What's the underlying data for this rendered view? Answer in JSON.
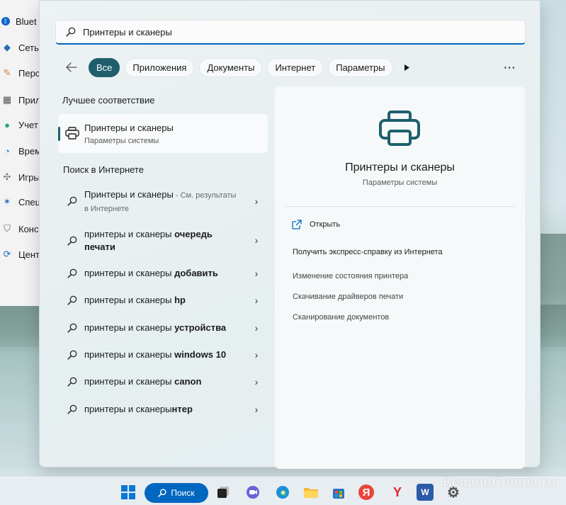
{
  "settings_sidebar": {
    "items": [
      {
        "label": "Bluet",
        "icon": "bluetooth-icon"
      },
      {
        "label": "Сеть",
        "icon": "network-icon"
      },
      {
        "label": "Перс",
        "icon": "personalization-icon"
      },
      {
        "label": "Прил",
        "icon": "apps-icon"
      },
      {
        "label": "Учет",
        "icon": "accounts-icon"
      },
      {
        "label": "Врем",
        "icon": "time-language-icon"
      },
      {
        "label": "Игры",
        "icon": "gaming-icon"
      },
      {
        "label": "Спец",
        "icon": "accessibility-icon"
      },
      {
        "label": "Конс",
        "icon": "privacy-shield-icon"
      },
      {
        "label": "Цент",
        "icon": "update-icon"
      }
    ]
  },
  "search": {
    "value": "Принтеры и сканеры"
  },
  "filters": {
    "tabs": [
      "Все",
      "Приложения",
      "Документы",
      "Интернет",
      "Параметры"
    ],
    "active": "Все"
  },
  "results": {
    "best_match_title": "Лучшее соответствие",
    "best_match": {
      "title": "Принтеры и сканеры",
      "subtitle": "Параметры системы"
    },
    "web_title": "Поиск в Интернете",
    "web_items": [
      {
        "prefix": "Принтеры и сканеры",
        "bold": "",
        "suffix": " - См. результаты в Интернете"
      },
      {
        "prefix": "принтеры и сканеры ",
        "bold": "очередь печати",
        "suffix": ""
      },
      {
        "prefix": "принтеры и сканеры ",
        "bold": "добавить",
        "suffix": ""
      },
      {
        "prefix": "принтеры и сканеры ",
        "bold": "hp",
        "suffix": ""
      },
      {
        "prefix": "принтеры и сканеры ",
        "bold": "устройства",
        "suffix": ""
      },
      {
        "prefix": "принтеры и сканеры ",
        "bold": "windows 10",
        "suffix": ""
      },
      {
        "prefix": "принтеры и сканеры ",
        "bold": "canon",
        "suffix": ""
      },
      {
        "prefix": "принтеры и сканеры",
        "bold": "нтер",
        "suffix": ""
      }
    ]
  },
  "preview": {
    "title": "Принтеры и сканеры",
    "subtitle": "Параметры системы",
    "open_label": "Открыть",
    "help_label": "Получить экспресс-справку из Интернета",
    "links": [
      "Изменение состояния принтера",
      "Скачивание драйверов печати",
      "Сканирование документов"
    ]
  },
  "taskbar": {
    "search_label": "Поиск",
    "apps": [
      "windows-start-icon",
      "search-icon",
      "task-view-icon",
      "chat-icon",
      "edge-icon",
      "file-explorer-icon",
      "store-icon",
      "yandex-icon",
      "yandex-browser-icon",
      "word-icon",
      "settings-gear-icon"
    ]
  },
  "watermark": "RemontCompa.ru",
  "colors": {
    "accent": "#1f5f6c",
    "search_accent": "#0067c0"
  }
}
